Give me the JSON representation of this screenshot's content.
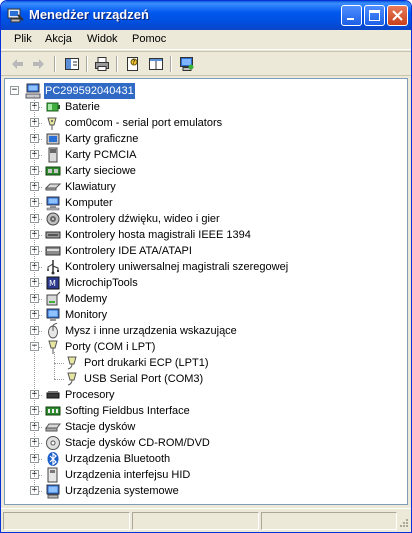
{
  "window": {
    "title": "Menedżer urządzeń"
  },
  "menu": [
    "Plik",
    "Akcja",
    "Widok",
    "Pomoc"
  ],
  "toolbar": {
    "buttons": [
      "back-icon",
      "forward-icon",
      "show-hide-tree-icon",
      "print-icon",
      "properties-icon",
      "help-icon",
      "scan-hardware-icon"
    ]
  },
  "tree": {
    "root": "PC299592040431",
    "categories": [
      {
        "label": "Baterie",
        "icon": "battery-icon"
      },
      {
        "label": "com0com - serial port emulators",
        "icon": "port-emulator-icon"
      },
      {
        "label": "Karty graficzne",
        "icon": "display-adapter-icon"
      },
      {
        "label": "Karty PCMCIA",
        "icon": "pcmcia-icon"
      },
      {
        "label": "Karty sieciowe",
        "icon": "network-card-icon"
      },
      {
        "label": "Klawiatury",
        "icon": "keyboard-icon"
      },
      {
        "label": "Komputer",
        "icon": "computer-icon"
      },
      {
        "label": "Kontrolery dźwięku, wideo i gier",
        "icon": "sound-icon"
      },
      {
        "label": "Kontrolery hosta magistrali IEEE 1394",
        "icon": "ieee1394-icon"
      },
      {
        "label": "Kontrolery IDE ATA/ATAPI",
        "icon": "ide-icon"
      },
      {
        "label": "Kontrolery uniwersalnej magistrali szeregowej",
        "icon": "usb-icon"
      },
      {
        "label": "MicrochipTools",
        "icon": "microchip-icon"
      },
      {
        "label": "Modemy",
        "icon": "modem-icon"
      },
      {
        "label": "Monitory",
        "icon": "monitor-icon"
      },
      {
        "label": "Mysz i inne urządzenia wskazujące",
        "icon": "mouse-icon"
      },
      {
        "label": "Porty (COM i LPT)",
        "icon": "ports-icon",
        "expanded": true,
        "children": [
          {
            "label": "Port drukarki ECP (LPT1)",
            "icon": "port-icon"
          },
          {
            "label": "USB Serial Port (COM3)",
            "icon": "port-icon"
          }
        ]
      },
      {
        "label": "Procesory",
        "icon": "processor-icon"
      },
      {
        "label": "Softing Fieldbus Interface",
        "icon": "fieldbus-icon"
      },
      {
        "label": "Stacje dysków",
        "icon": "disk-drive-icon"
      },
      {
        "label": "Stacje dysków CD-ROM/DVD",
        "icon": "cdrom-icon"
      },
      {
        "label": "Urządzenia Bluetooth",
        "icon": "bluetooth-icon"
      },
      {
        "label": "Urządzenia interfejsu HID",
        "icon": "hid-icon"
      },
      {
        "label": "Urządzenia systemowe",
        "icon": "system-devices-icon"
      }
    ]
  },
  "colors": {
    "selection": "#316ac5",
    "titlebar": "#0058ee",
    "window_bg": "#ece9d8"
  }
}
